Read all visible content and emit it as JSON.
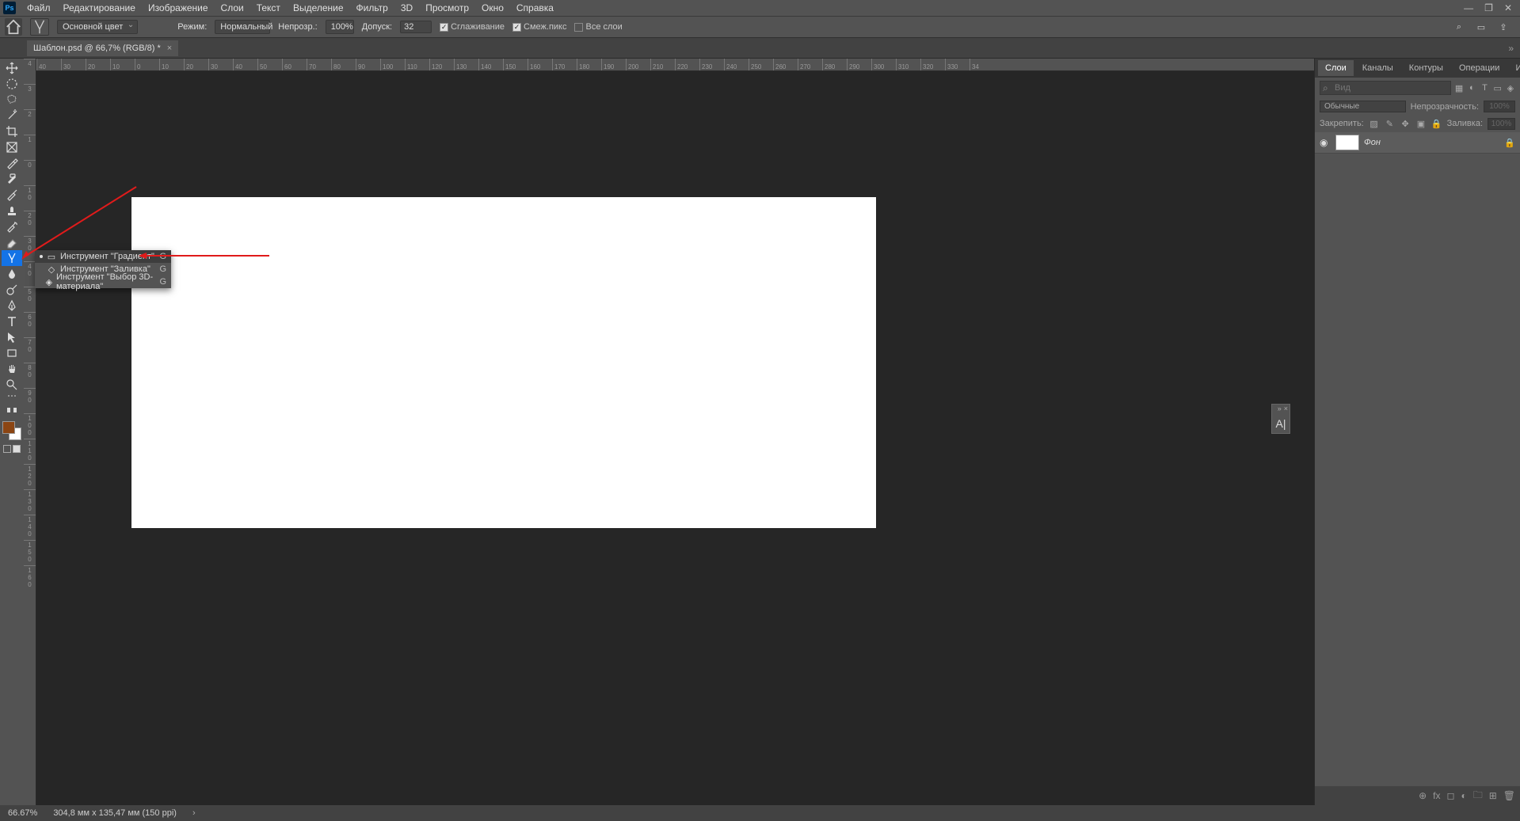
{
  "menubar": {
    "items": [
      "Файл",
      "Редактирование",
      "Изображение",
      "Слои",
      "Текст",
      "Выделение",
      "Фильтр",
      "3D",
      "Просмотр",
      "Окно",
      "Справка"
    ]
  },
  "optbar": {
    "preset": "Основной цвет",
    "mode_label": "Режим:",
    "mode": "Нормальный",
    "opacity_label": "Непрозр.:",
    "opacity": "100%",
    "tolerance_label": "Допуск:",
    "tolerance": "32",
    "smooth": "Сглаживание",
    "contiguous": "Смеж.пикс",
    "alllayers": "Все слои"
  },
  "doc": {
    "title": "Шаблон.psd @ 66,7% (RGB/8) *"
  },
  "hruler": [
    "40",
    "30",
    "20",
    "10",
    "0",
    "10",
    "20",
    "30",
    "40",
    "50",
    "60",
    "70",
    "80",
    "90",
    "100",
    "110",
    "120",
    "130",
    "140",
    "150",
    "160",
    "170",
    "180",
    "190",
    "200",
    "210",
    "220",
    "230",
    "240",
    "250",
    "260",
    "270",
    "280",
    "290",
    "300",
    "310",
    "320",
    "330",
    "34"
  ],
  "vruler": [
    "4",
    "3",
    "2",
    "1",
    "0",
    "1 0",
    "2 0",
    "3 0",
    "4 0",
    "5 0",
    "6 0",
    "7 0",
    "8 0",
    "9 0",
    "1 0 0",
    "1 1 0",
    "1 2 0",
    "1 3 0",
    "1 4 0",
    "1 5 0",
    "1 6 0"
  ],
  "flyout": {
    "items": [
      {
        "label": "Инструмент \"Градиент\"",
        "key": "G",
        "selected": true
      },
      {
        "label": "Инструмент \"Заливка\"",
        "key": "G",
        "selected": false
      },
      {
        "label": "Инструмент \"Выбор 3D-материала\"",
        "key": "G",
        "selected": false
      }
    ]
  },
  "panels": {
    "tabs": [
      "Слои",
      "Каналы",
      "Контуры",
      "Операции",
      "История"
    ],
    "search_placeholder": "Вид",
    "blend": "Обычные",
    "opacity_label": "Непрозрачность:",
    "opacity_val": "100%",
    "lock_label": "Закрепить:",
    "fill_label": "Заливка:",
    "fill_val": "100%",
    "layer_name": "Фон"
  },
  "status": {
    "zoom": "66.67%",
    "dims": "304,8 мм x 135,47 мм (150 ppi)"
  },
  "a_popup": "A|"
}
